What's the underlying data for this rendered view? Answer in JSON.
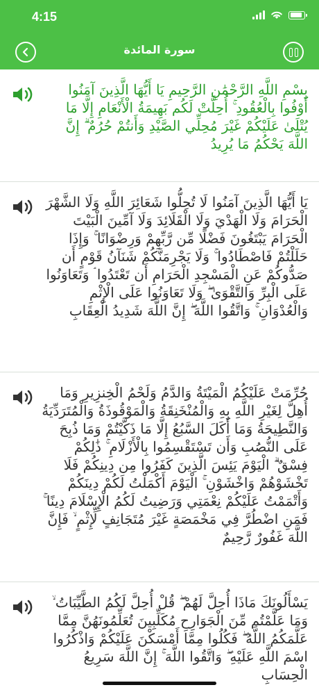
{
  "status_bar": {
    "time": "4:15",
    "battery_level": 0.9,
    "signal_icon": "signal-icon",
    "wifi_icon": "wifi-icon"
  },
  "nav": {
    "title": "سورة المائدة",
    "back_icon": "chevron-left-icon",
    "pause_icon": "pause-icon"
  },
  "colors": {
    "primary": "#4cc046",
    "active_text": "#2e9f2e",
    "text": "#333333",
    "divider": "#d9e0d9"
  },
  "verses": [
    {
      "text": "بِسْمِ اللَّهِ الرَّحْمَٰنِ الرَّحِيمِ يَا أَيُّهَا الَّذِينَ آمَنُوا أَوْفُوا بِالْعُقُودِ ۚ أُحِلَّتْ لَكُم بَهِيمَةُ الْأَنْعَامِ إِلَّا مَا يُتْلَىٰ عَلَيْكُمْ غَيْرَ مُحِلِّي الصَّيْدِ وَأَنتُمْ حُرُمٌ ۗ إِنَّ اللَّهَ يَحْكُمُ مَا يُرِيدُ",
      "active": true
    },
    {
      "text": "يَا أَيُّهَا الَّذِينَ آمَنُوا لَا تُحِلُّوا شَعَائِرَ اللَّهِ وَلَا الشَّهْرَ الْحَرَامَ وَلَا الْهَدْيَ وَلَا الْقَلَائِدَ وَلَا آمِّينَ الْبَيْتَ الْحَرَامَ يَبْتَغُونَ فَضْلًا مِّن رَّبِّهِمْ وَرِضْوَانًا ۚ وَإِذَا حَلَلْتُمْ فَاصْطَادُوا ۚ وَلَا يَجْرِمَنَّكُمْ شَنَآنُ قَوْمٍ أَن صَدُّوكُمْ عَنِ الْمَسْجِدِ الْحَرَامِ أَن تَعْتَدُوا ۘ وَتَعَاوَنُوا عَلَى الْبِرِّ وَالتَّقْوَىٰ ۖ وَلَا تَعَاوَنُوا عَلَى الْإِثْمِ وَالْعُدْوَانِ ۚ وَاتَّقُوا اللَّهَ ۖ إِنَّ اللَّهَ شَدِيدُ الْعِقَابِ",
      "active": false
    },
    {
      "text": "حُرِّمَتْ عَلَيْكُمُ الْمَيْتَةُ وَالدَّمُ وَلَحْمُ الْخِنزِيرِ وَمَا أُهِلَّ لِغَيْرِ اللَّهِ بِهِ وَالْمُنْخَنِقَةُ وَالْمَوْقُوذَةُ وَالْمُتَرَدِّيَةُ وَالنَّطِيحَةُ وَمَا أَكَلَ السَّبُعُ إِلَّا مَا ذَكَّيْتُمْ وَمَا ذُبِحَ عَلَى النُّصُبِ وَأَن تَسْتَقْسِمُوا بِالْأَزْلَامِ ۚ ذَٰلِكُمْ فِسْقٌ ۗ الْيَوْمَ يَئِسَ الَّذِينَ كَفَرُوا مِن دِينِكُمْ فَلَا تَخْشَوْهُمْ وَاخْشَوْنِ ۚ الْيَوْمَ أَكْمَلْتُ لَكُمْ دِينَكُمْ وَأَتْمَمْتُ عَلَيْكُمْ نِعْمَتِي وَرَضِيتُ لَكُمُ الْإِسْلَامَ دِينًا ۚ فَمَنِ اضْطُرَّ فِي مَخْمَصَةٍ غَيْرَ مُتَجَانِفٍ لِّإِثْمٍ ۙ فَإِنَّ اللَّهَ غَفُورٌ رَّحِيمٌ",
      "active": false
    },
    {
      "text": "يَسْأَلُونَكَ مَاذَا أُحِلَّ لَهُمْ ۖ قُلْ أُحِلَّ لَكُمُ الطَّيِّبَاتُ ۙ وَمَا عَلَّمْتُم مِّنَ الْجَوَارِحِ مُكَلِّبِينَ تُعَلِّمُونَهُنَّ مِمَّا عَلَّمَكُمُ اللَّهُ ۖ فَكُلُوا مِمَّا أَمْسَكْنَ عَلَيْكُمْ وَاذْكُرُوا اسْمَ اللَّهِ عَلَيْهِ ۖ وَاتَّقُوا اللَّهَ ۚ إِنَّ اللَّهَ سَرِيعُ الْحِسَابِ",
      "active": false
    }
  ]
}
